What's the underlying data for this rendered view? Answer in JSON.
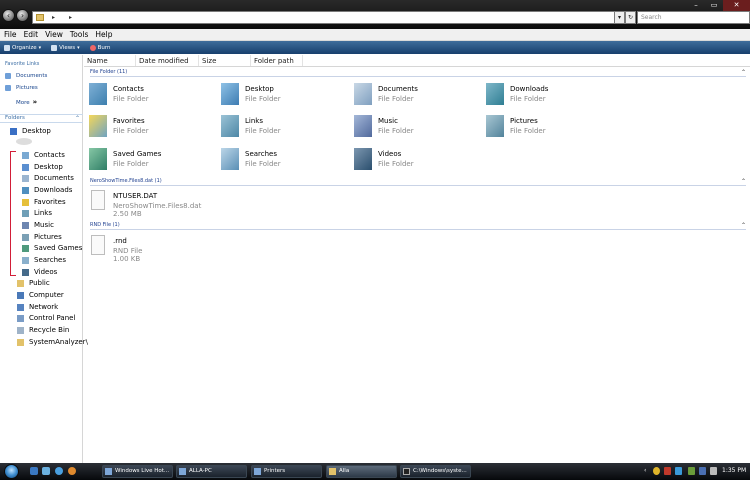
{
  "search": {
    "placeholder": "Search"
  },
  "menubar": [
    "File",
    "Edit",
    "View",
    "Tools",
    "Help"
  ],
  "toolbar": {
    "organize": "Organize",
    "views": "Views",
    "burn": "Burn"
  },
  "nav": {
    "favorites_header": "Favorite Links",
    "favorites": [
      "Documents",
      "Pictures"
    ],
    "more": "More",
    "folders_header": "Folders",
    "tree": [
      "Desktop",
      "Contacts",
      "Desktop",
      "Documents",
      "Downloads",
      "Favorites",
      "Links",
      "Music",
      "Pictures",
      "Saved Games",
      "Searches",
      "Videos",
      "Public",
      "Computer",
      "Network",
      "Control Panel",
      "Recycle Bin",
      "SystemAnalyzer\\"
    ]
  },
  "columns": [
    "Name",
    "Date modified",
    "Size",
    "Folder path"
  ],
  "groups": {
    "folders": {
      "header": "File Folder (11)",
      "items": [
        {
          "name": "Contacts",
          "type": "File Folder"
        },
        {
          "name": "Desktop",
          "type": "File Folder"
        },
        {
          "name": "Documents",
          "type": "File Folder"
        },
        {
          "name": "Downloads",
          "type": "File Folder"
        },
        {
          "name": "Favorites",
          "type": "File Folder"
        },
        {
          "name": "Links",
          "type": "File Folder"
        },
        {
          "name": "Music",
          "type": "File Folder"
        },
        {
          "name": "Pictures",
          "type": "File Folder"
        },
        {
          "name": "Saved Games",
          "type": "File Folder"
        },
        {
          "name": "Searches",
          "type": "File Folder"
        },
        {
          "name": "Videos",
          "type": "File Folder"
        }
      ]
    },
    "nero": {
      "header": "NeroShowTime.Files8.dat (1)",
      "item": {
        "name": "NTUSER.DAT",
        "type": "NeroShowTime.Files8.dat",
        "size": "2.50 MB"
      }
    },
    "rnd": {
      "header": "RND File (1)",
      "item": {
        "name": ".rnd",
        "type": "RND File",
        "size": "1.00 KB"
      }
    }
  },
  "taskbar": {
    "tasks": [
      "Windows Live Hot...",
      "ALLA-PC",
      "Printers",
      "Alla",
      "C:\\Windows\\syste..."
    ],
    "clock": "1:35 PM"
  },
  "colors": {
    "toolbar": "#1f4a7a",
    "link": "#15428b",
    "annotation": "#d21e38"
  }
}
